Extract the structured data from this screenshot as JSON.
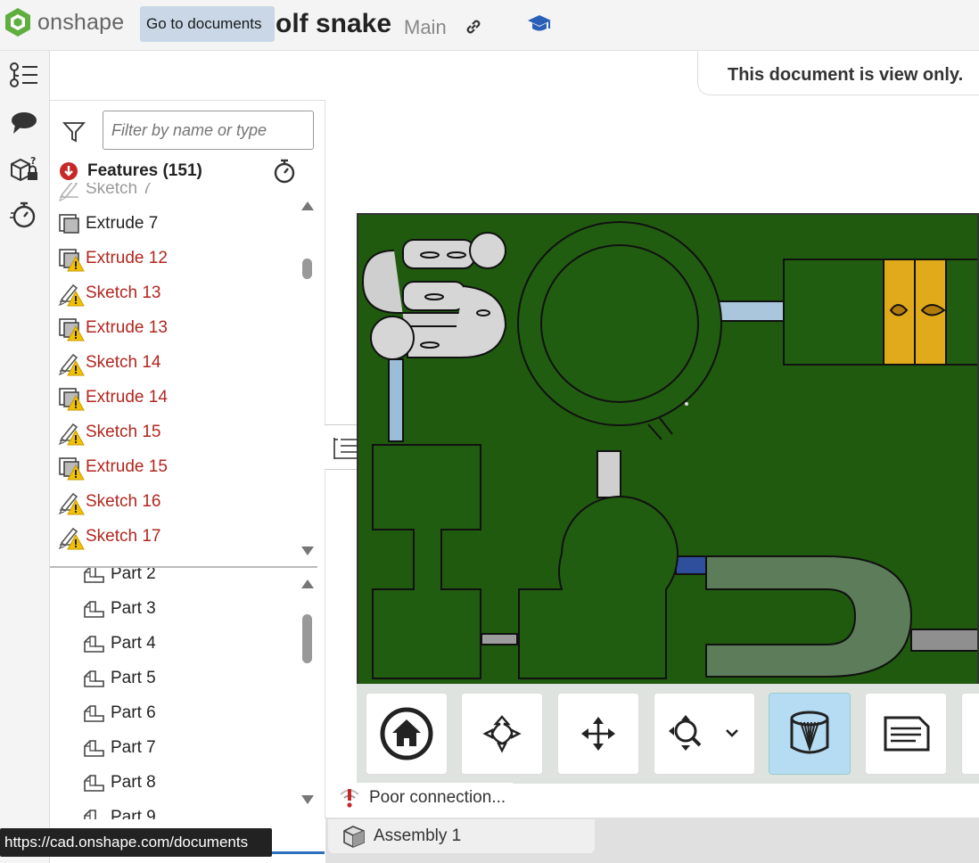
{
  "app": {
    "brand": "onshape",
    "tooltip": "Go to documents",
    "document_title": "olf snake",
    "branch": "Main"
  },
  "notice": {
    "view_only": "This document is view only."
  },
  "filter": {
    "placeholder": "Filter by name or type"
  },
  "features": {
    "header": "Features (151)",
    "items": [
      {
        "label": "Sketch 7",
        "type": "sketch",
        "state": "normal"
      },
      {
        "label": "Extrude 7",
        "type": "extrude",
        "state": "normal"
      },
      {
        "label": "Extrude 12",
        "type": "extrude",
        "state": "warning"
      },
      {
        "label": "Sketch 13",
        "type": "sketch",
        "state": "warning"
      },
      {
        "label": "Extrude 13",
        "type": "extrude",
        "state": "warning"
      },
      {
        "label": "Sketch 14",
        "type": "sketch",
        "state": "warning"
      },
      {
        "label": "Extrude 14",
        "type": "extrude",
        "state": "warning"
      },
      {
        "label": "Sketch 15",
        "type": "sketch",
        "state": "warning"
      },
      {
        "label": "Extrude 15",
        "type": "extrude",
        "state": "warning"
      },
      {
        "label": "Sketch 16",
        "type": "sketch",
        "state": "warning"
      },
      {
        "label": "Sketch 17",
        "type": "sketch",
        "state": "warning"
      }
    ]
  },
  "parts": {
    "items": [
      "Part 2",
      "Part 3",
      "Part 4",
      "Part 5",
      "Part 6",
      "Part 7",
      "Part 8",
      "Part 9"
    ]
  },
  "toolbar": {
    "buttons": [
      "home-view",
      "rotate",
      "pan",
      "zoom",
      "section-view",
      "named-views"
    ]
  },
  "status": {
    "connection": "Poor connection..."
  },
  "tabs": {
    "assembly": "Assembly 1"
  },
  "browser": {
    "status_url": "https://cad.onshape.com/documents"
  },
  "colors": {
    "warning": "#b3261e",
    "accent": "#2b6fbf",
    "board": "#1f5a0e"
  }
}
